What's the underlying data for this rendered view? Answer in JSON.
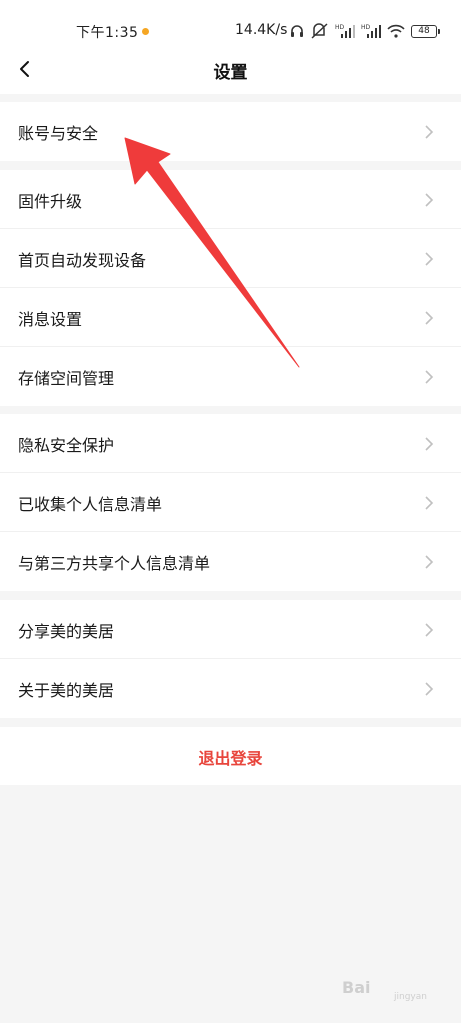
{
  "status_bar": {
    "time": "下午1:35",
    "speed": "14.4K/s",
    "battery": "48",
    "icons": [
      "headphones-icon",
      "mute-icon",
      "signal-hd-icon",
      "signal-hd-icon",
      "wifi-icon",
      "battery-icon"
    ],
    "dot_color": "#f5a623"
  },
  "nav": {
    "title": "设置",
    "back_icon": "chevron-left-icon"
  },
  "groups": [
    {
      "items": [
        {
          "label": "账号与安全"
        }
      ]
    },
    {
      "items": [
        {
          "label": "固件升级"
        },
        {
          "label": "首页自动发现设备"
        },
        {
          "label": "消息设置"
        },
        {
          "label": "存储空间管理"
        }
      ]
    },
    {
      "items": [
        {
          "label": "隐私安全保护"
        },
        {
          "label": "已收集个人信息清单"
        },
        {
          "label": "与第三方共享个人信息清单"
        }
      ]
    },
    {
      "items": [
        {
          "label": "分享美的美居"
        },
        {
          "label": "关于美的美居"
        }
      ]
    }
  ],
  "logout": {
    "label": "退出登录",
    "color": "#e8453c"
  },
  "annotation": {
    "arrow_color": "#ef3b3b"
  },
  "watermark": {
    "text": "Bai",
    "sub": "jingyan"
  },
  "colors": {
    "background": "#f5f5f5",
    "card": "#ffffff",
    "chevron": "#c0c0c0"
  }
}
